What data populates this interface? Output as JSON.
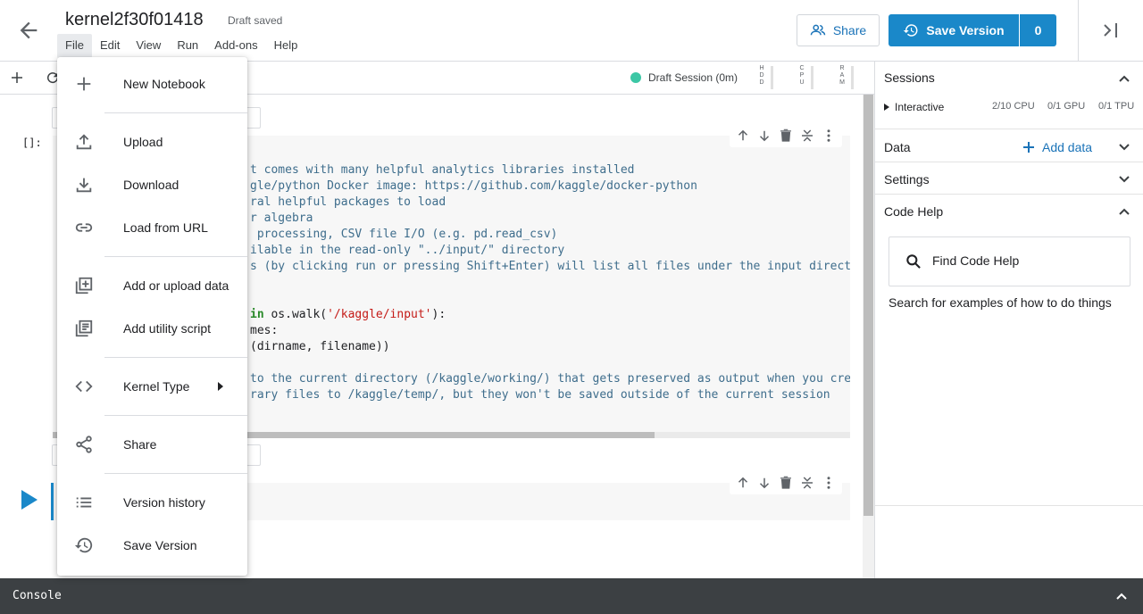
{
  "header": {
    "title": "kernel2f30f01418",
    "status": "Draft saved",
    "menu": [
      "File",
      "Edit",
      "View",
      "Run",
      "Add-ons",
      "Help"
    ],
    "share_label": "Share",
    "save_version_label": "Save Version",
    "version_count": "0"
  },
  "toolbar": {
    "session_label": "Draft Session (0m)",
    "meters": [
      "H D D",
      "C P U",
      "R A M"
    ]
  },
  "cells": [
    {
      "prompt": "[]:"
    },
    {
      "prompt": ""
    }
  ],
  "code_lines": [
    "t comes with many helpful analytics libraries installed",
    "gle/python Docker image: https://github.com/kaggle/docker-python",
    "ral helpful packages to load",
    "",
    "r algebra",
    " processing, CSV file I/O (e.g. pd.read_csv)",
    "",
    "ilable in the read-only \"../input/\" directory",
    "s (by clicking run or pressing Shift+Enter) will list all files under the input directo",
    "",
    "",
    "in os.walk('/kaggle/input'):",
    "mes:",
    "(dirname, filename))",
    "",
    "to the current directory (/kaggle/working/) that gets preserved as output when you crea",
    "rary files to /kaggle/temp/, but they won't be saved outside of the current session"
  ],
  "file_menu": {
    "items": [
      {
        "label": "New Notebook",
        "icon": "plus-icon"
      },
      {
        "label": "Upload",
        "icon": "upload-icon"
      },
      {
        "label": "Download",
        "icon": "download-icon"
      },
      {
        "label": "Load from URL",
        "icon": "link-icon"
      },
      {
        "label": "Add or upload data",
        "icon": "add-box-icon"
      },
      {
        "label": "Add utility script",
        "icon": "library-icon"
      },
      {
        "label": "Kernel Type",
        "icon": "code-icon"
      },
      {
        "label": "Share",
        "icon": "share-icon"
      },
      {
        "label": "Version history",
        "icon": "list-icon"
      },
      {
        "label": "Save Version",
        "icon": "history-icon"
      }
    ]
  },
  "right_panel": {
    "sessions_title": "Sessions",
    "interactive_label": "Interactive",
    "cpu": "2/10 CPU",
    "gpu": "0/1 GPU",
    "tpu": "0/1 TPU",
    "data_title": "Data",
    "add_data_label": "Add data",
    "settings_title": "Settings",
    "code_help_title": "Code Help",
    "find_code_help_label": "Find Code Help",
    "code_help_desc": "Search for examples of how to do things"
  },
  "console": {
    "label": "Console"
  },
  "colors": {
    "accent": "#1a88c9",
    "session_dot": "#3cc7a5",
    "console_bg": "#3c4043"
  }
}
